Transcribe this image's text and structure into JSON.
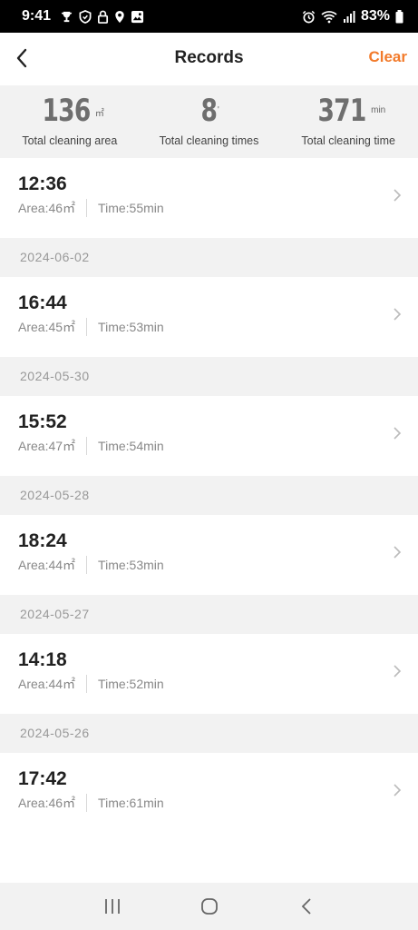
{
  "status_bar": {
    "time": "9:41",
    "battery": "83%",
    "left_icons": [
      "trophy-icon",
      "shield-icon",
      "lock-icon",
      "location-icon",
      "image-icon"
    ],
    "right_icons": [
      "alarm-icon",
      "wifi-icon",
      "signal-icon",
      "battery-icon"
    ]
  },
  "header": {
    "title": "Records",
    "clear_label": "Clear",
    "accent_color": "#f27a2a"
  },
  "summary": {
    "area": {
      "value": "136",
      "unit": "㎡",
      "label": "Total cleaning area"
    },
    "times": {
      "value": "8",
      "unit": "'",
      "label": "Total cleaning times"
    },
    "time": {
      "value": "371",
      "unit": "min",
      "label": "Total cleaning time"
    }
  },
  "records": [
    {
      "time": "12:36",
      "area": "Area:46㎡",
      "duration": "Time:55min"
    },
    {
      "date": "2024-06-02",
      "time": "16:44",
      "area": "Area:45㎡",
      "duration": "Time:53min"
    },
    {
      "date": "2024-05-30",
      "time": "15:52",
      "area": "Area:47㎡",
      "duration": "Time:54min"
    },
    {
      "date": "2024-05-28",
      "time": "18:24",
      "area": "Area:44㎡",
      "duration": "Time:53min"
    },
    {
      "date": "2024-05-27",
      "time": "14:18",
      "area": "Area:44㎡",
      "duration": "Time:52min"
    },
    {
      "date": "2024-05-26",
      "time": "17:42",
      "area": "Area:46㎡",
      "duration": "Time:61min"
    }
  ],
  "nav_bar": {
    "buttons": [
      "recents-icon",
      "home-icon",
      "back-icon"
    ]
  }
}
